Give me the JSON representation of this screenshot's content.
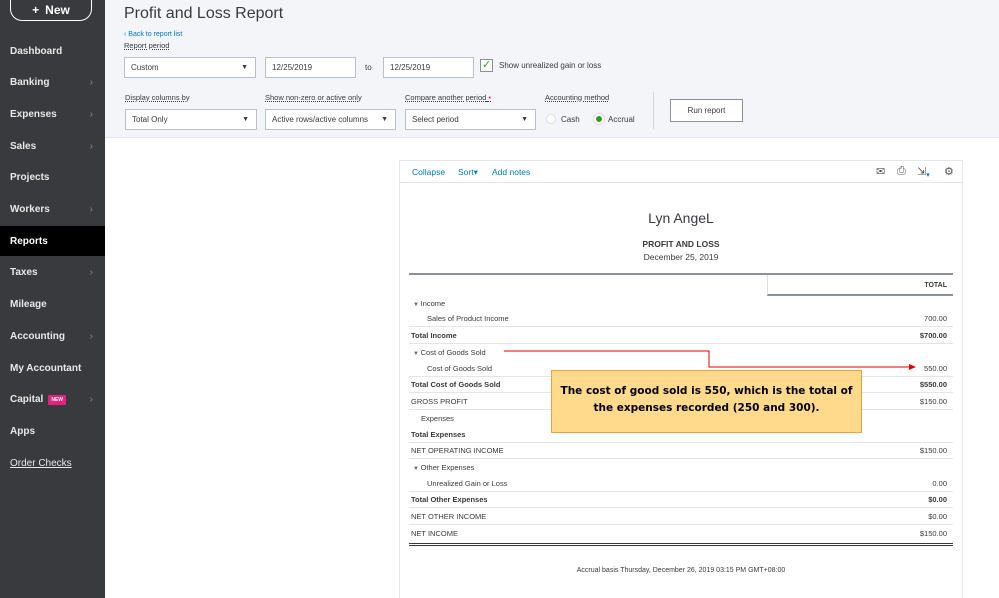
{
  "sidebar": {
    "new_label": "New",
    "items": [
      {
        "label": "Dashboard",
        "chev": false
      },
      {
        "label": "Banking",
        "chev": true
      },
      {
        "label": "Expenses",
        "chev": true
      },
      {
        "label": "Sales",
        "chev": true
      },
      {
        "label": "Projects",
        "chev": false
      },
      {
        "label": "Workers",
        "chev": true
      },
      {
        "label": "Reports",
        "chev": false,
        "active": true
      },
      {
        "label": "Taxes",
        "chev": true
      },
      {
        "label": "Mileage",
        "chev": false
      },
      {
        "label": "Accounting",
        "chev": true
      },
      {
        "label": "My Accountant",
        "chev": false
      },
      {
        "label": "Capital",
        "chev": true,
        "badge": "NEW"
      },
      {
        "label": "Apps",
        "chev": false
      },
      {
        "label": "Order Checks",
        "chev": false,
        "link": true
      }
    ]
  },
  "header": {
    "title": "Profit and Loss Report",
    "back": "Back to report list"
  },
  "filters": {
    "report_period_label": "Report period",
    "period": "Custom",
    "from": "12/25/2019",
    "to_label": "to",
    "to": "12/25/2019",
    "unrealized_label": "Show unrealized gain or loss",
    "unrealized_checked": true,
    "display_label": "Display columns by",
    "display": "Total Only",
    "nonzero_label": "Show non-zero or active only",
    "nonzero": "Active rows/active columns",
    "compare_label": "Compare another period",
    "compare": "Select period",
    "method_label": "Accounting method",
    "cash": "Cash",
    "accrual": "Accrual",
    "method": "Accrual",
    "run": "Run report"
  },
  "toolbar": {
    "collapse": "Collapse",
    "sort": "Sort",
    "notes": "Add notes"
  },
  "report": {
    "company": "Lyn AngeL",
    "title": "PROFIT AND LOSS",
    "date": "December 25, 2019",
    "col": "TOTAL",
    "rows": [
      {
        "label": "Income",
        "value": "",
        "indent": 0,
        "caret": true
      },
      {
        "label": "Sales of Product Income",
        "value": "700.00",
        "indent": 2
      },
      {
        "label": "Total Income",
        "value": "$700.00",
        "bold": true
      },
      {
        "label": "Cost of Goods Sold",
        "value": "",
        "caret": true
      },
      {
        "label": "Cost of Goods Sold",
        "value": "550.00",
        "indent": 2
      },
      {
        "label": "Total Cost of Goods Sold",
        "value": "$550.00",
        "bold": true
      },
      {
        "label": "GROSS PROFIT",
        "value": "$150.00"
      },
      {
        "label": "Expenses",
        "value": "",
        "indent": 1
      },
      {
        "label": "Total Expenses",
        "value": "",
        "bold": true
      },
      {
        "label": "NET OPERATING INCOME",
        "value": "$150.00"
      },
      {
        "label": "Other Expenses",
        "value": "",
        "caret": true
      },
      {
        "label": "Unrealized Gain or Loss",
        "value": "0.00",
        "indent": 2
      },
      {
        "label": "Total Other Expenses",
        "value": "$0.00",
        "bold": true
      },
      {
        "label": "NET OTHER INCOME",
        "value": "$0.00"
      },
      {
        "label": "NET INCOME",
        "value": "$150.00"
      }
    ],
    "footer": "Accrual basis  Thursday, December 26, 2019  03:15 PM GMT+08:00"
  },
  "annotation": {
    "text": "The cost of good sold is 550, which is the total of the expenses recorded (250 and 300).",
    "color": "#ffd98c",
    "arrow_color": "#e00000"
  }
}
